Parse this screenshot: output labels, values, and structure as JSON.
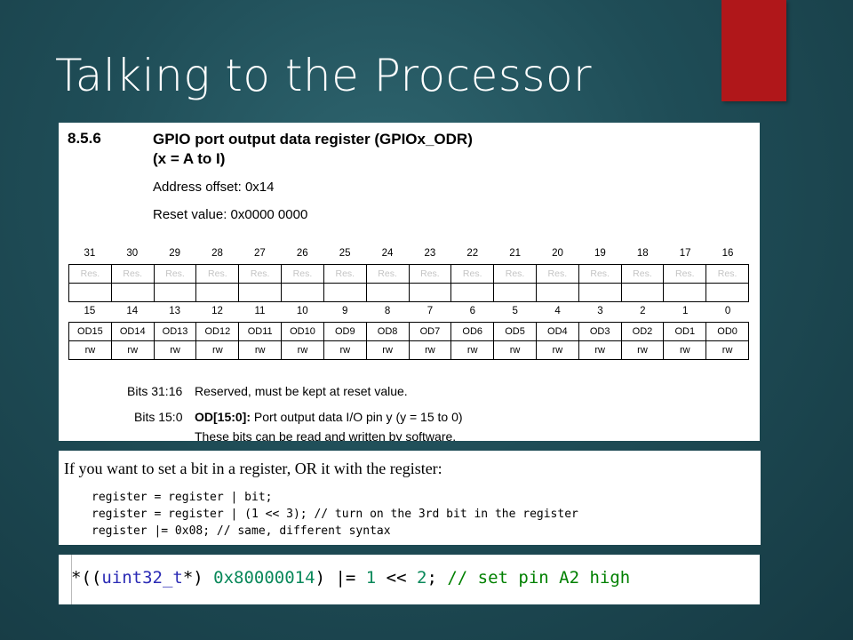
{
  "slide": {
    "title": "Talking to the Processor",
    "accent_color": "#b0171a"
  },
  "register_doc": {
    "section_number": "8.5.6",
    "title_line1": "GPIO port output data register (GPIOx_ODR)",
    "title_line2": "(x = A to I)",
    "address_offset": "Address offset: 0x14",
    "reset_value": "Reset value: 0x0000 0000",
    "upper_bits": [
      "31",
      "30",
      "29",
      "28",
      "27",
      "26",
      "25",
      "24",
      "23",
      "22",
      "21",
      "20",
      "19",
      "18",
      "17",
      "16"
    ],
    "upper_fields": [
      "Res.",
      "Res.",
      "Res.",
      "Res.",
      "Res.",
      "Res.",
      "Res.",
      "Res.",
      "Res.",
      "Res.",
      "Res.",
      "Res.",
      "Res.",
      "Res.",
      "Res.",
      "Res."
    ],
    "lower_bits": [
      "15",
      "14",
      "13",
      "12",
      "11",
      "10",
      "9",
      "8",
      "7",
      "6",
      "5",
      "4",
      "3",
      "2",
      "1",
      "0"
    ],
    "lower_fields": [
      "OD15",
      "OD14",
      "OD13",
      "OD12",
      "OD11",
      "OD10",
      "OD9",
      "OD8",
      "OD7",
      "OD6",
      "OD5",
      "OD4",
      "OD3",
      "OD2",
      "OD1",
      "OD0"
    ],
    "lower_access": [
      "rw",
      "rw",
      "rw",
      "rw",
      "rw",
      "rw",
      "rw",
      "rw",
      "rw",
      "rw",
      "rw",
      "rw",
      "rw",
      "rw",
      "rw",
      "rw"
    ],
    "desc1_bits": "Bits 31:16",
    "desc1_text": "Reserved, must be kept at reset value.",
    "desc2_bits": "Bits 15:0",
    "desc2_field": "OD[15:0]:",
    "desc2_text": "Port output data I/O pin y (y = 15 to 0)",
    "desc2_line2": "These bits can be read and written by software."
  },
  "or_example": {
    "intro": "If you want to set a bit in a register, OR it with the register:",
    "code_lines": [
      "register = register | bit;",
      "register = register | (1 << 3); // turn on the 3rd bit in the register",
      "register |= 0x08;               // same, different syntax"
    ]
  },
  "code_example": {
    "tokens": [
      {
        "t": "*((",
        "c": "#000000"
      },
      {
        "t": "uint32_t",
        "c": "#2b2bb5"
      },
      {
        "t": "*) ",
        "c": "#000000"
      },
      {
        "t": "0x80000014",
        "c": "#09885a"
      },
      {
        "t": ") |= ",
        "c": "#000000"
      },
      {
        "t": "1",
        "c": "#09885a"
      },
      {
        "t": " << ",
        "c": "#000000"
      },
      {
        "t": "2",
        "c": "#09885a"
      },
      {
        "t": "; ",
        "c": "#000000"
      },
      {
        "t": "// set pin A2 high",
        "c": "#008000"
      }
    ]
  }
}
